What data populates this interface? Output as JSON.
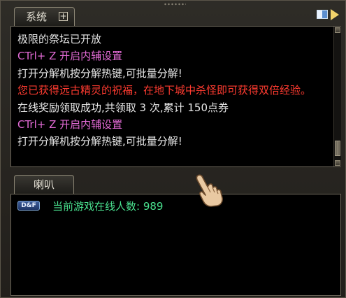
{
  "tabs": {
    "system_label": "系统",
    "system_plus": "+",
    "horn_label": "喇叭"
  },
  "chat": {
    "lines": [
      {
        "text": "极限的祭坛已开放",
        "color": "#e8e8e8"
      },
      {
        "text": "CTrl+ Z 开启内辅设置",
        "color": "#e36bd6"
      },
      {
        "text": "打开分解机按分解热键,可批量分解!",
        "color": "#e8e8e8"
      },
      {
        "text": "您已获得远古精灵的祝福，在地下城中杀怪即可获得双倍经验。",
        "color": "#ff3b30"
      },
      {
        "text": "在线奖励领取成功,共领取 3 次,累计 150点券",
        "color": "#e8e8e8"
      },
      {
        "text": "CTrl+ Z 开启内辅设置",
        "color": "#e36bd6"
      },
      {
        "text": "打开分解机按分解热键,可批量分解!",
        "color": "#e8e8e8"
      }
    ]
  },
  "horn": {
    "badge": "D&F",
    "message": "当前游戏在线人数: 989",
    "color": "#49e08e"
  },
  "icons": {
    "top_right": [
      "window-mode-icon",
      "expand-arrow-icon"
    ],
    "cursor": "hand-cursor-icon"
  }
}
